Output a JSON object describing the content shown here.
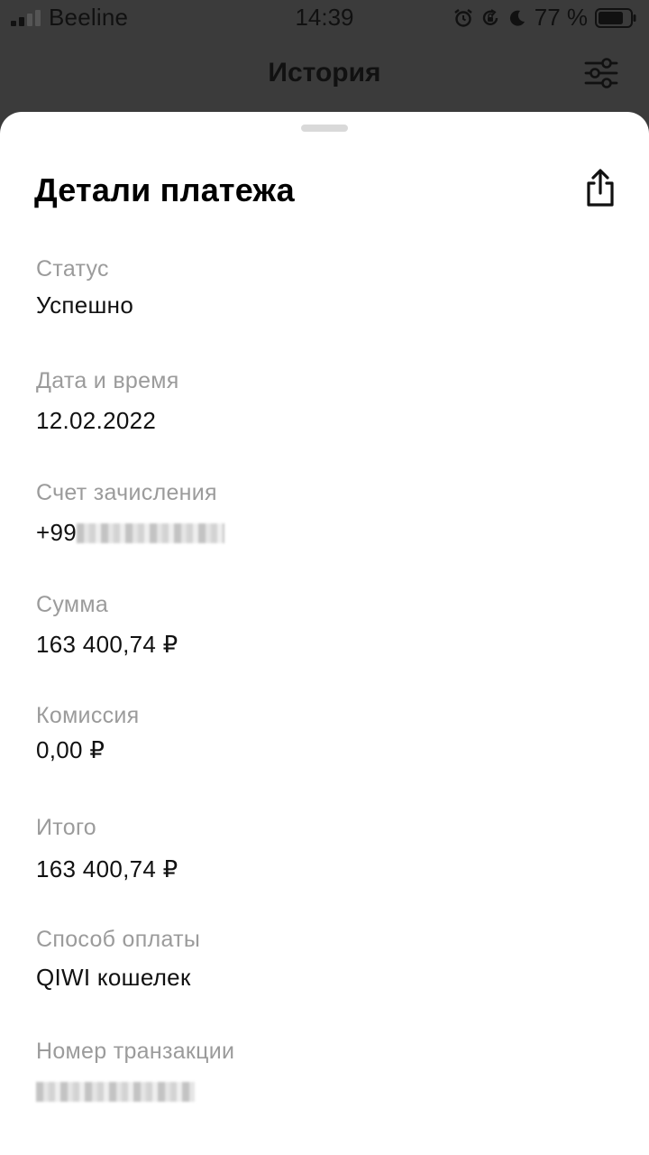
{
  "status_bar": {
    "carrier": "Beeline",
    "time": "14:39",
    "battery_percent": "77 %",
    "icons": [
      "signal-icon",
      "alarm-icon",
      "rotation-lock-icon",
      "moon-icon",
      "battery-icon"
    ]
  },
  "header": {
    "title": "История",
    "filter_icon": "sliders-icon"
  },
  "sheet": {
    "title": "Детали платежа",
    "share_icon": "share-icon",
    "fields": [
      {
        "label": "Статус",
        "value": "Успешно"
      },
      {
        "label": "Дата и время",
        "value": "12.02.2022"
      },
      {
        "label": "Счет зачисления",
        "value": "+99"
      },
      {
        "label": "Сумма",
        "value": "163 400,74 ₽"
      },
      {
        "label": "Комиссия",
        "value": "0,00 ₽"
      },
      {
        "label": "Итого",
        "value": "163 400,74 ₽"
      },
      {
        "label": "Способ оплаты",
        "value": "QIWI кошелек"
      },
      {
        "label": "Номер транзакции",
        "value": ""
      }
    ]
  },
  "colors": {
    "backdrop": "#3b3b3b",
    "sheet": "#ffffff",
    "label": "#9b9b9b",
    "value": "#111111"
  }
}
